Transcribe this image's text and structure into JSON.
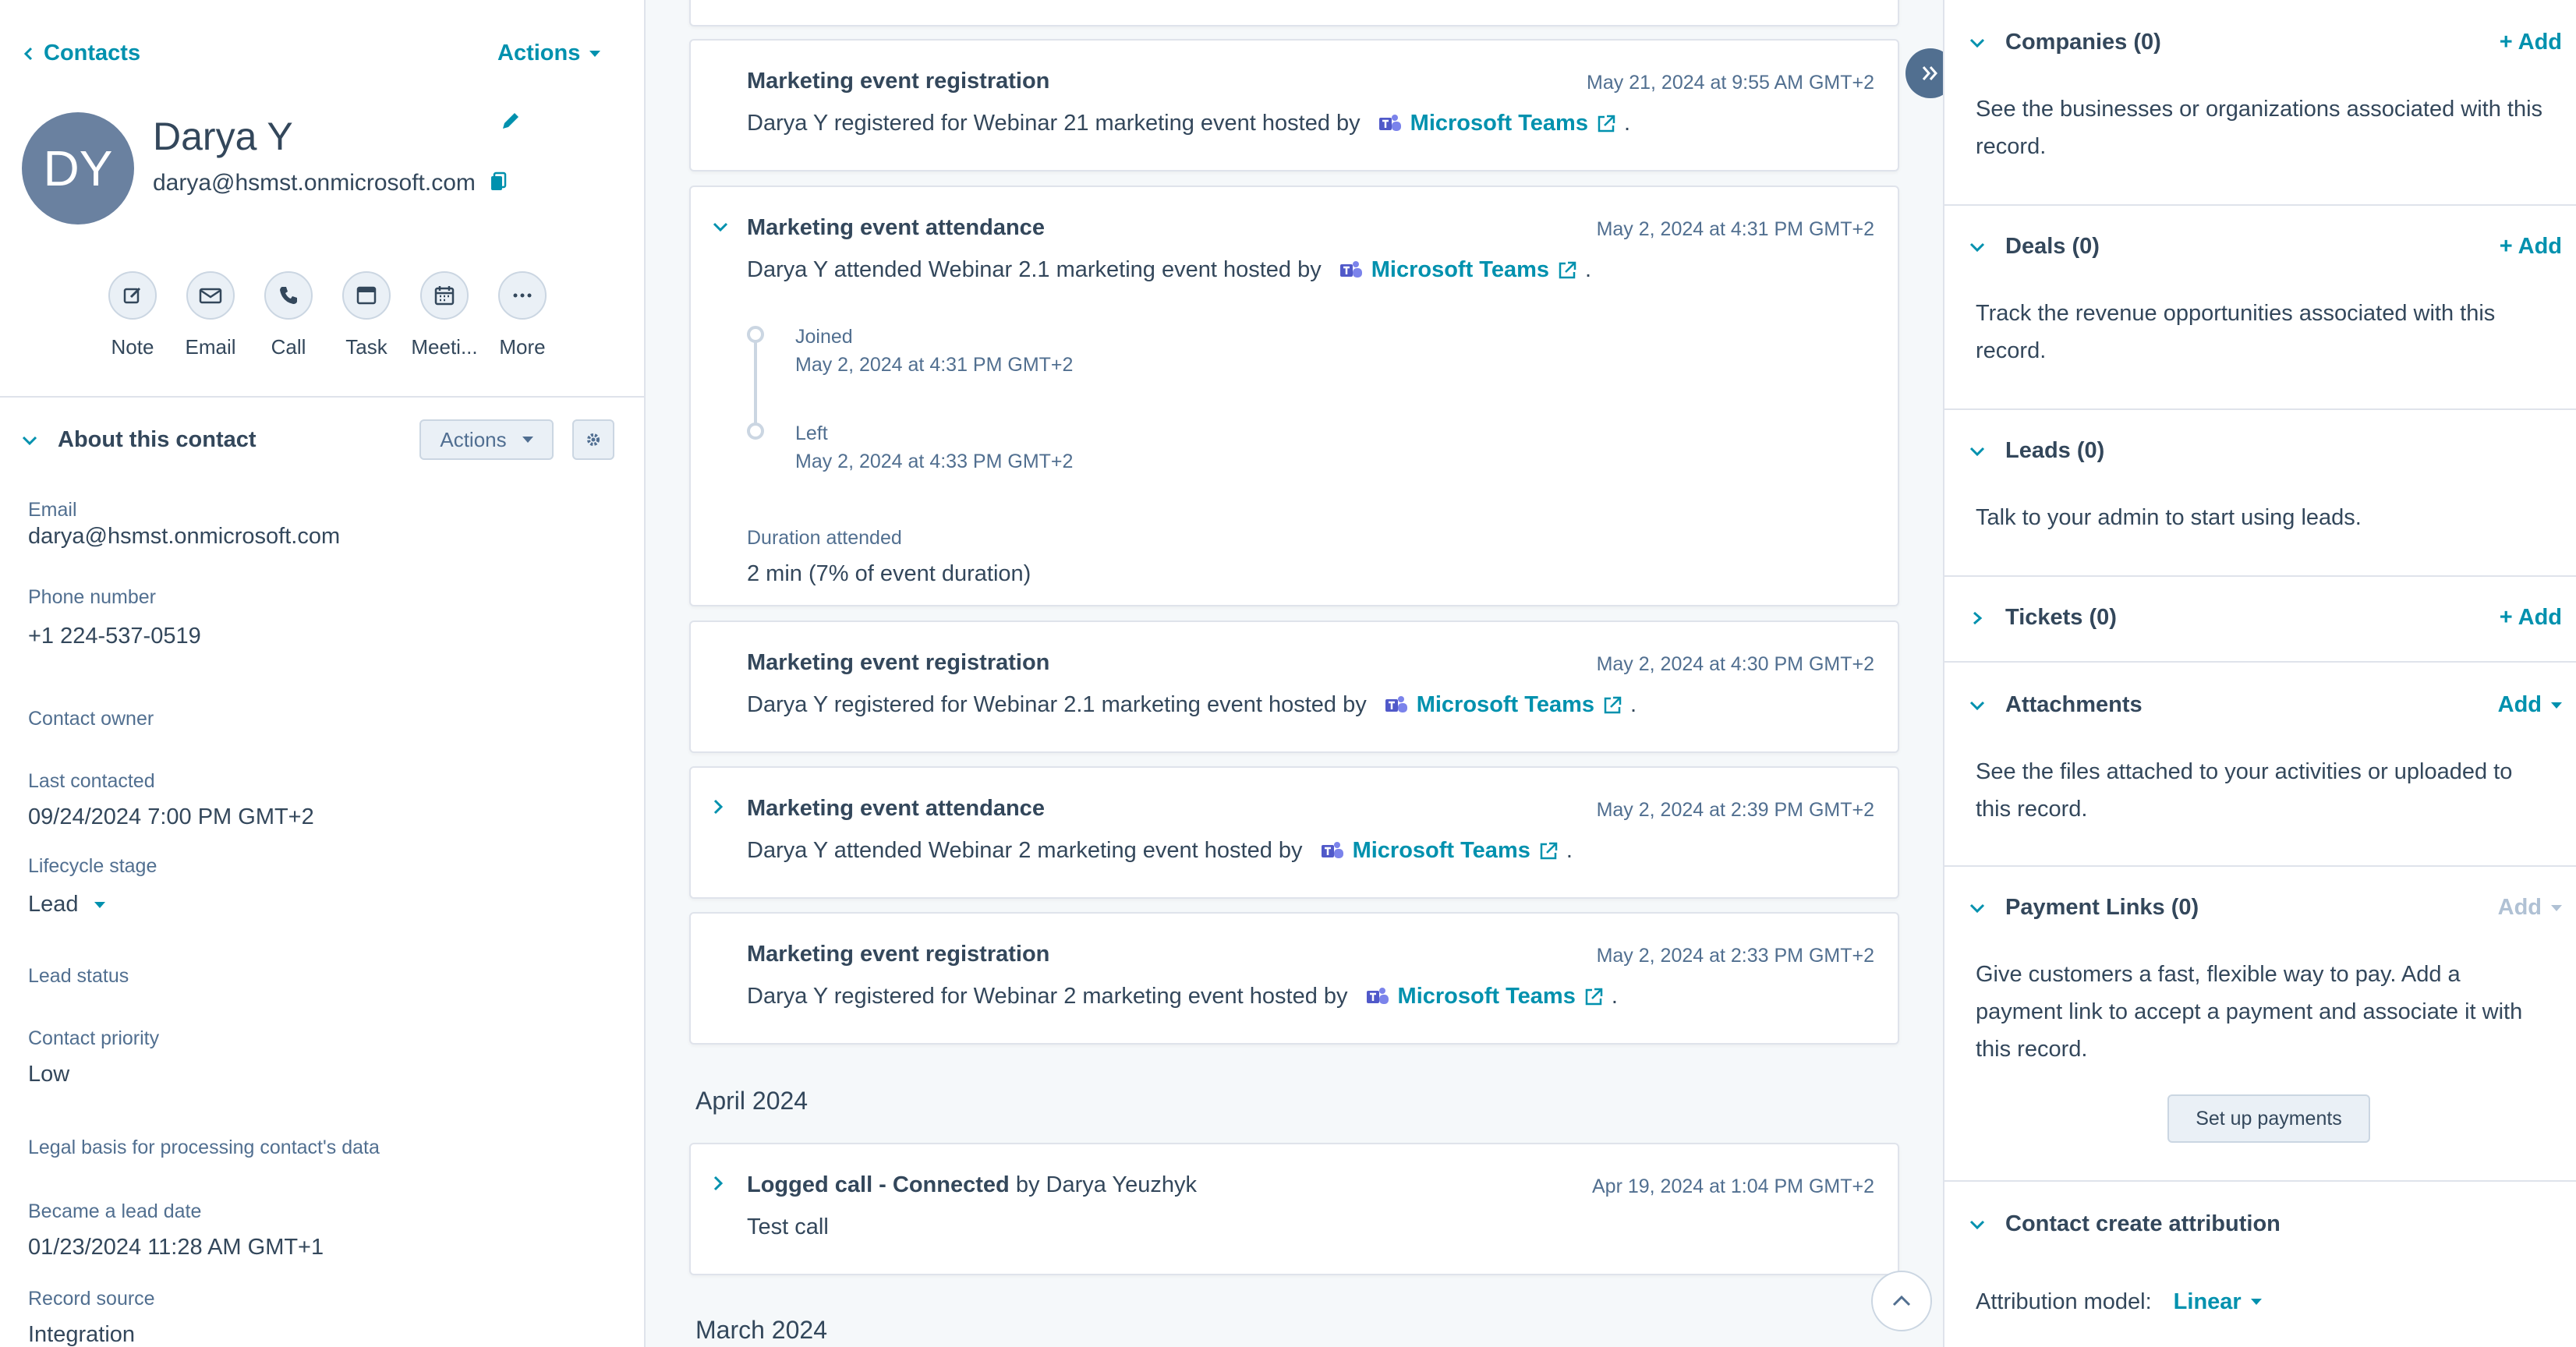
{
  "left": {
    "back_label": "Contacts",
    "actions_label": "Actions",
    "avatar_initials": "DY",
    "name": "Darya Y",
    "email": "darya@hsmst.onmicrosoft.com",
    "quick_actions": [
      "Note",
      "Email",
      "Call",
      "Task",
      "Meeti...",
      "More"
    ],
    "about": {
      "title": "About this contact",
      "actions_label": "Actions"
    },
    "properties": {
      "email_label": "Email",
      "email_value": "darya@hsmst.onmicrosoft.com",
      "phone_label": "Phone number",
      "phone_value": "+1 224-537-0519",
      "owner_label": "Contact owner",
      "last_contacted_label": "Last contacted",
      "last_contacted_value": "09/24/2024 7:00 PM GMT+2",
      "lifecycle_label": "Lifecycle stage",
      "lifecycle_value": "Lead",
      "lead_status_label": "Lead status",
      "priority_label": "Contact priority",
      "priority_value": "Low",
      "legal_label": "Legal basis for processing contact's data",
      "lead_date_label": "Became a lead date",
      "lead_date_value": "01/23/2024 11:28 AM GMT+1",
      "source_label": "Record source",
      "source_value": "Integration"
    }
  },
  "timeline": {
    "teams_label": "Microsoft Teams",
    "period": ".",
    "cards": [
      {
        "title": "Marketing event registration",
        "ts": "May 21, 2024 at 9:55 AM GMT+2",
        "text": "Darya Y registered for Webinar 21 marketing event hosted by"
      },
      {
        "title": "Marketing event attendance",
        "ts": "May 2, 2024 at 4:31 PM GMT+2",
        "text": "Darya Y attended Webinar 2.1 marketing event hosted by",
        "joined_label": "Joined",
        "joined_ts": "May 2, 2024 at 4:31 PM GMT+2",
        "left_label": "Left",
        "left_ts": "May 2, 2024 at 4:33 PM GMT+2",
        "duration_label": "Duration attended",
        "duration_value": "2 min (7% of event duration)"
      },
      {
        "title": "Marketing event registration",
        "ts": "May 2, 2024 at 4:30 PM GMT+2",
        "text": "Darya Y registered for Webinar 2.1 marketing event hosted by"
      },
      {
        "title": "Marketing event attendance",
        "ts": "May 2, 2024 at 2:39 PM GMT+2",
        "text": "Darya Y attended Webinar 2 marketing event hosted by"
      },
      {
        "title": "Marketing event registration",
        "ts": "May 2, 2024 at 2:33 PM GMT+2",
        "text": "Darya Y registered for Webinar 2 marketing event hosted by"
      }
    ],
    "month_april": "April 2024",
    "call": {
      "title": "Logged call - Connected",
      "by": "by Darya Yeuzhyk",
      "ts": "Apr 19, 2024 at 1:04 PM GMT+2",
      "text": "Test call"
    },
    "month_march": "March 2024"
  },
  "right": {
    "companies": {
      "title": "Companies (0)",
      "add": "+ Add",
      "desc": "See the businesses or organizations associated with this record."
    },
    "deals": {
      "title": "Deals (0)",
      "add": "+ Add",
      "desc": "Track the revenue opportunities associated with this record."
    },
    "leads": {
      "title": "Leads (0)",
      "desc": "Talk to your admin to start using leads."
    },
    "tickets": {
      "title": "Tickets (0)",
      "add": "+ Add"
    },
    "attachments": {
      "title": "Attachments",
      "add": "Add",
      "desc": "See the files attached to your activities or uploaded to this record."
    },
    "payment": {
      "title": "Payment Links (0)",
      "add": "Add",
      "desc": "Give customers a fast, flexible way to pay. Add a payment link to accept a payment and associate it with this record.",
      "button": "Set up payments"
    },
    "attribution": {
      "title": "Contact create attribution",
      "model_label": "Attribution model:",
      "model_value": "Linear"
    }
  },
  "colors": {
    "accent": "#0091ae",
    "text": "#33475b",
    "muted": "#516f90",
    "border": "#dfe3eb",
    "teams": "#5059c9"
  }
}
